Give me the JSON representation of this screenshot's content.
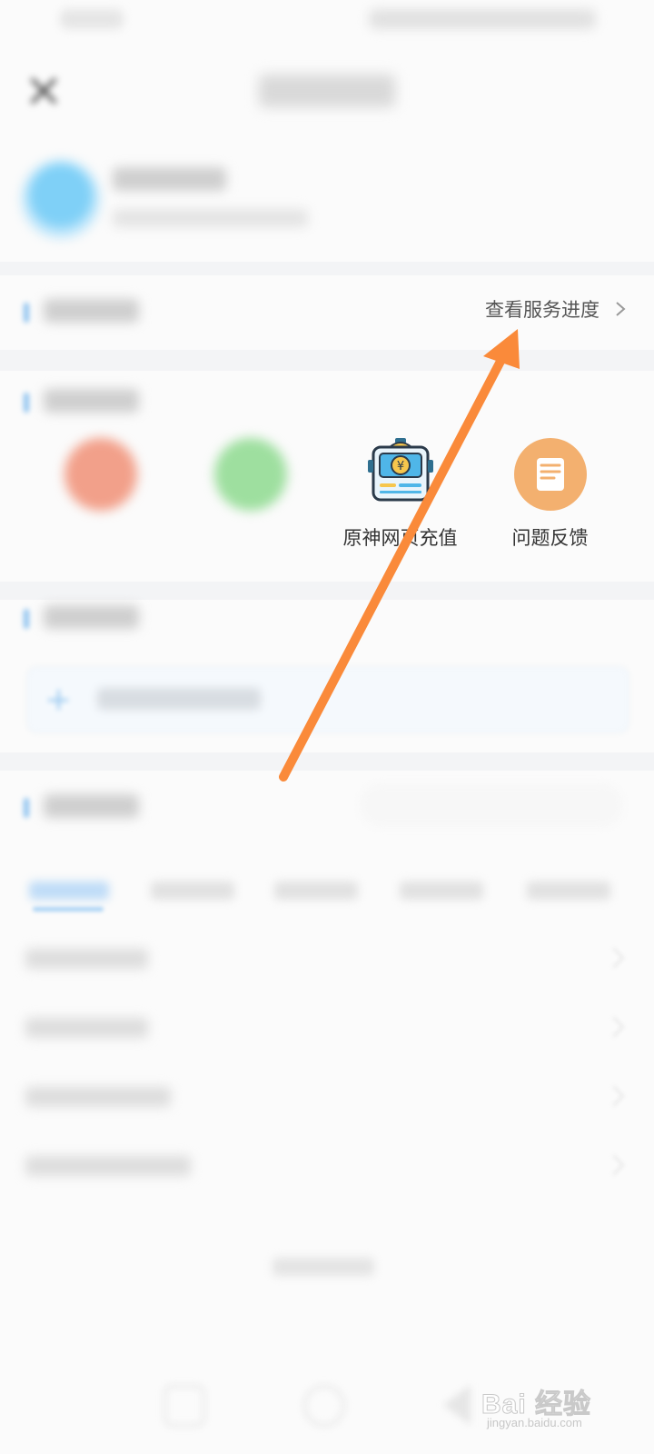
{
  "service": {
    "progress_label": "查看服务进度"
  },
  "quick_actions": [
    {
      "label": "",
      "icon": "orange-circle-icon",
      "color": "#f2a08a",
      "blurred": true
    },
    {
      "label": "",
      "icon": "search-icon",
      "color": "#9edf9f",
      "blurred": true
    },
    {
      "label": "原神网页充值",
      "icon": "robot-recharge-icon",
      "blurred": false
    },
    {
      "label": "问题反馈",
      "icon": "feedback-note-icon",
      "color": "#f3b06f",
      "blurred": false
    }
  ],
  "annotation": {
    "arrow_color": "#fa8a3a"
  },
  "watermark": {
    "brand": "Bai  经验",
    "url": "jingyan.baidu.com"
  }
}
